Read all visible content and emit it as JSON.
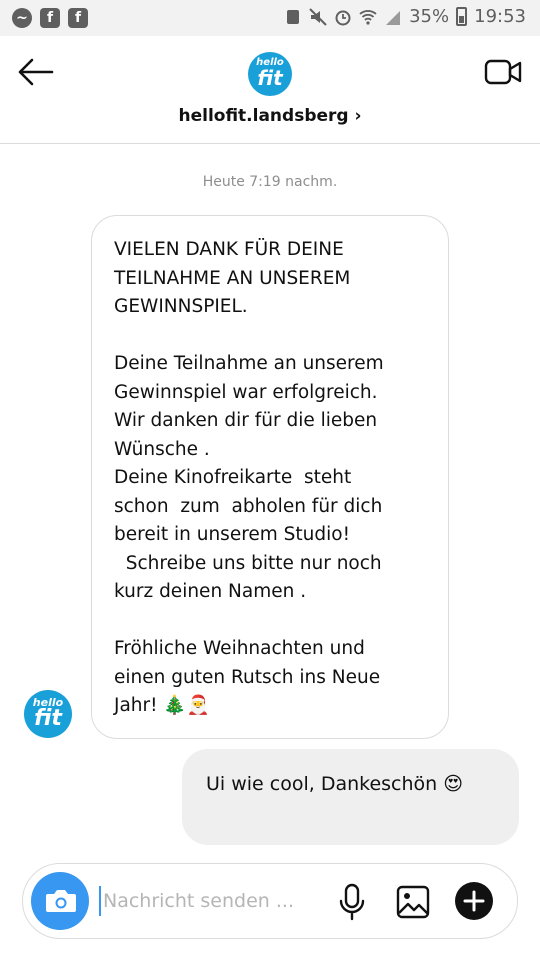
{
  "status_bar": {
    "battery": "35%",
    "time": "19:53"
  },
  "header": {
    "logo_text_top": "hello",
    "logo_text_bottom": "fit",
    "username": "hellofit.landsberg ›"
  },
  "chat": {
    "timestamp": "Heute 7:19 nachm.",
    "incoming_message": "VIELEN DANK FÜR DEINE\nTEILNAHME AN UNSEREM\nGEWINNSPIEL.\n\nDeine Teilnahme an unserem\nGewinnspiel war erfolgreich.\nWir danken dir für die lieben\nWünsche .\nDeine Kinofreikarte  steht\nschon  zum  abholen für dich\nbereit in unserem Studio!\n  Schreibe uns bitte nur noch\nkurz deinen Namen .\n\nFröhliche Weihnachten und\neinen guten Rutsch ins Neue\nJahr! 🎄🎅",
    "outgoing_message": "Ui wie cool, Dankeschön 😍"
  },
  "composer": {
    "placeholder": "Nachricht senden ..."
  },
  "icons": {
    "back": "arrow-left-icon",
    "video": "video-camera-icon",
    "camera": "camera-icon",
    "mic": "microphone-icon",
    "gallery": "image-icon",
    "plus": "plus-icon"
  },
  "colors": {
    "accent": "#3897f0",
    "brand": "#1aa0d8"
  }
}
